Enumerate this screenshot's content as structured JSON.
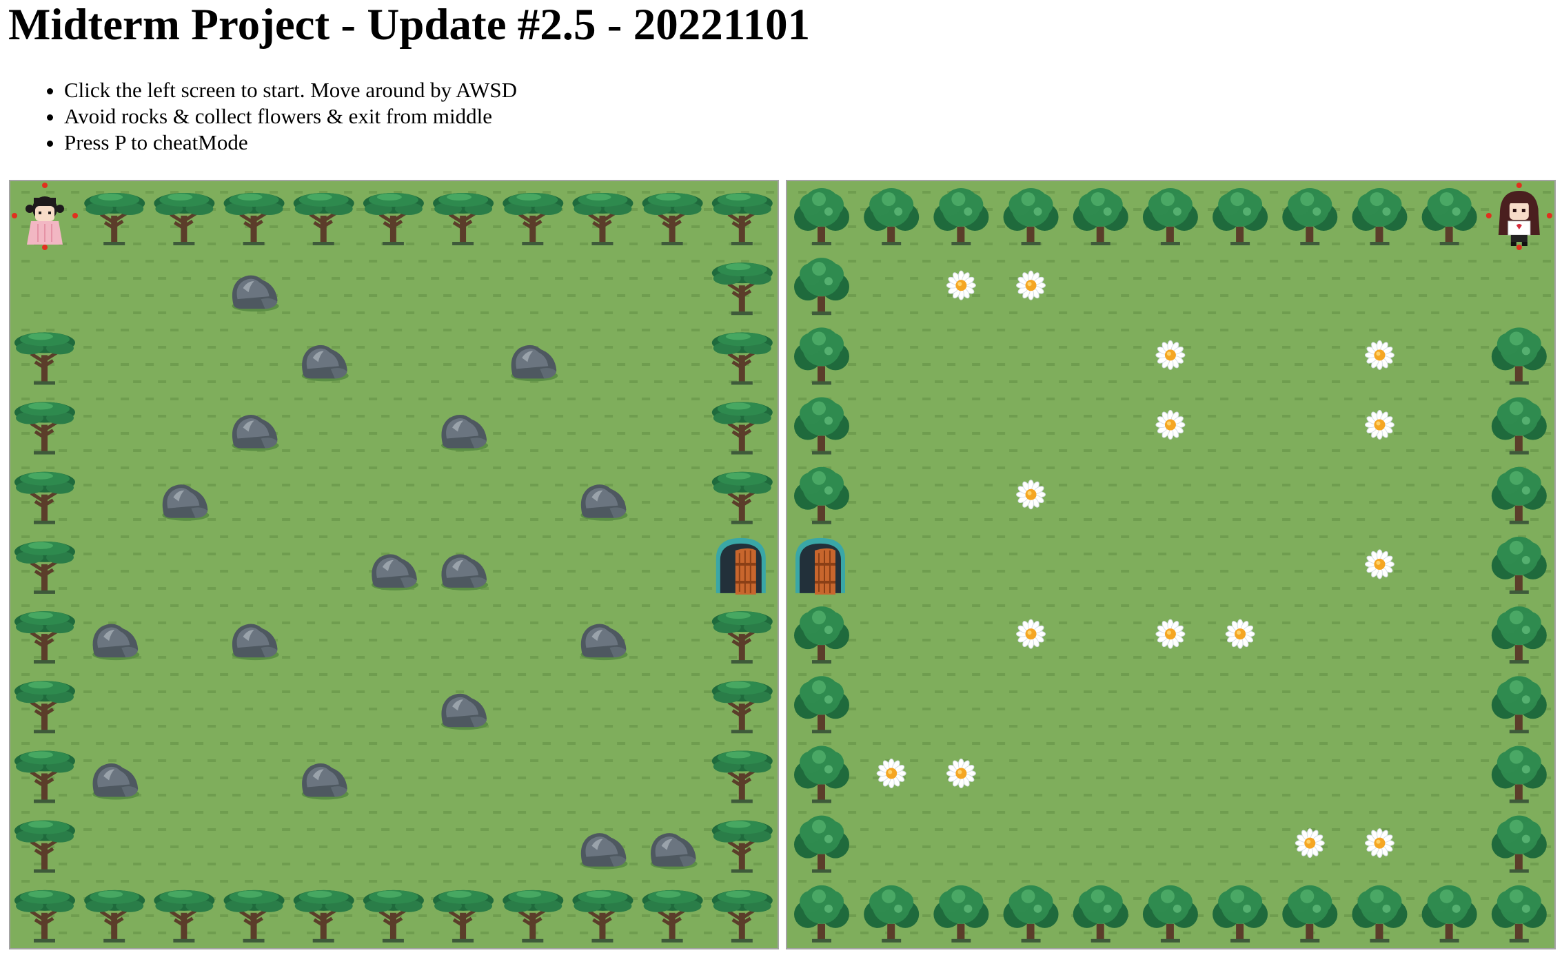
{
  "title": "Midterm Project - Update #2.5 - 20221101",
  "instructions": [
    "Click the left screen to start. Move around by AWSD",
    "Avoid rocks & collect flowers & exit from middle",
    "Press P to cheatMode"
  ],
  "colors": {
    "grass": "#7fae5c",
    "grass_dash": "#6f9d4f",
    "trunk": "#5b3d2a",
    "leaf": "#2e8a4e",
    "rock": "#6b7580",
    "flower_petal": "#ffffff",
    "flower_center": "#f5a623",
    "door_wood": "#c8662d",
    "door_arch": "#3aa7a7"
  },
  "grid": {
    "rows": 11,
    "cols": 11
  },
  "boards": {
    "left": {
      "name": "left-board",
      "tree_style": "acacia",
      "trees": [
        [
          0,
          1
        ],
        [
          0,
          2
        ],
        [
          0,
          3
        ],
        [
          0,
          4
        ],
        [
          0,
          5
        ],
        [
          0,
          6
        ],
        [
          0,
          7
        ],
        [
          0,
          8
        ],
        [
          0,
          9
        ],
        [
          0,
          10
        ],
        [
          1,
          10
        ],
        [
          2,
          0
        ],
        [
          2,
          10
        ],
        [
          3,
          0
        ],
        [
          3,
          10
        ],
        [
          4,
          0
        ],
        [
          4,
          10
        ],
        [
          5,
          0
        ],
        [
          6,
          0
        ],
        [
          6,
          10
        ],
        [
          7,
          0
        ],
        [
          7,
          10
        ],
        [
          8,
          0
        ],
        [
          8,
          10
        ],
        [
          9,
          0
        ],
        [
          9,
          10
        ],
        [
          10,
          0
        ],
        [
          10,
          1
        ],
        [
          10,
          2
        ],
        [
          10,
          3
        ],
        [
          10,
          4
        ],
        [
          10,
          5
        ],
        [
          10,
          6
        ],
        [
          10,
          7
        ],
        [
          10,
          8
        ],
        [
          10,
          9
        ],
        [
          10,
          10
        ]
      ],
      "rocks": [
        [
          1,
          3
        ],
        [
          2,
          4
        ],
        [
          2,
          7
        ],
        [
          3,
          3
        ],
        [
          3,
          6
        ],
        [
          4,
          2
        ],
        [
          4,
          8
        ],
        [
          5,
          5
        ],
        [
          5,
          6
        ],
        [
          6,
          1
        ],
        [
          6,
          3
        ],
        [
          6,
          8
        ],
        [
          7,
          6
        ],
        [
          8,
          1
        ],
        [
          8,
          4
        ],
        [
          9,
          8
        ],
        [
          9,
          9
        ]
      ],
      "flowers": [],
      "doors": [
        [
          5,
          10
        ]
      ],
      "player": {
        "row": 0,
        "col": 0,
        "sprite": "girl-pink-dress"
      }
    },
    "right": {
      "name": "right-board",
      "tree_style": "bush",
      "trees": [
        [
          0,
          0
        ],
        [
          0,
          1
        ],
        [
          0,
          2
        ],
        [
          0,
          3
        ],
        [
          0,
          4
        ],
        [
          0,
          5
        ],
        [
          0,
          6
        ],
        [
          0,
          7
        ],
        [
          0,
          8
        ],
        [
          0,
          9
        ],
        [
          1,
          0
        ],
        [
          2,
          0
        ],
        [
          2,
          10
        ],
        [
          3,
          0
        ],
        [
          3,
          10
        ],
        [
          4,
          0
        ],
        [
          4,
          10
        ],
        [
          5,
          10
        ],
        [
          6,
          0
        ],
        [
          6,
          10
        ],
        [
          7,
          0
        ],
        [
          7,
          10
        ],
        [
          8,
          0
        ],
        [
          8,
          10
        ],
        [
          9,
          0
        ],
        [
          9,
          10
        ],
        [
          10,
          0
        ],
        [
          10,
          1
        ],
        [
          10,
          2
        ],
        [
          10,
          3
        ],
        [
          10,
          4
        ],
        [
          10,
          5
        ],
        [
          10,
          6
        ],
        [
          10,
          7
        ],
        [
          10,
          8
        ],
        [
          10,
          9
        ],
        [
          10,
          10
        ]
      ],
      "rocks": [],
      "flowers": [
        [
          1,
          2
        ],
        [
          1,
          3
        ],
        [
          2,
          5
        ],
        [
          2,
          8
        ],
        [
          3,
          5
        ],
        [
          3,
          8
        ],
        [
          4,
          3
        ],
        [
          5,
          8
        ],
        [
          6,
          3
        ],
        [
          6,
          5
        ],
        [
          6,
          6
        ],
        [
          8,
          1
        ],
        [
          8,
          2
        ],
        [
          9,
          7
        ],
        [
          9,
          8
        ]
      ],
      "doors": [
        [
          5,
          0
        ]
      ],
      "player": {
        "row": 0,
        "col": 10,
        "sprite": "girl-brown-hair"
      }
    }
  }
}
